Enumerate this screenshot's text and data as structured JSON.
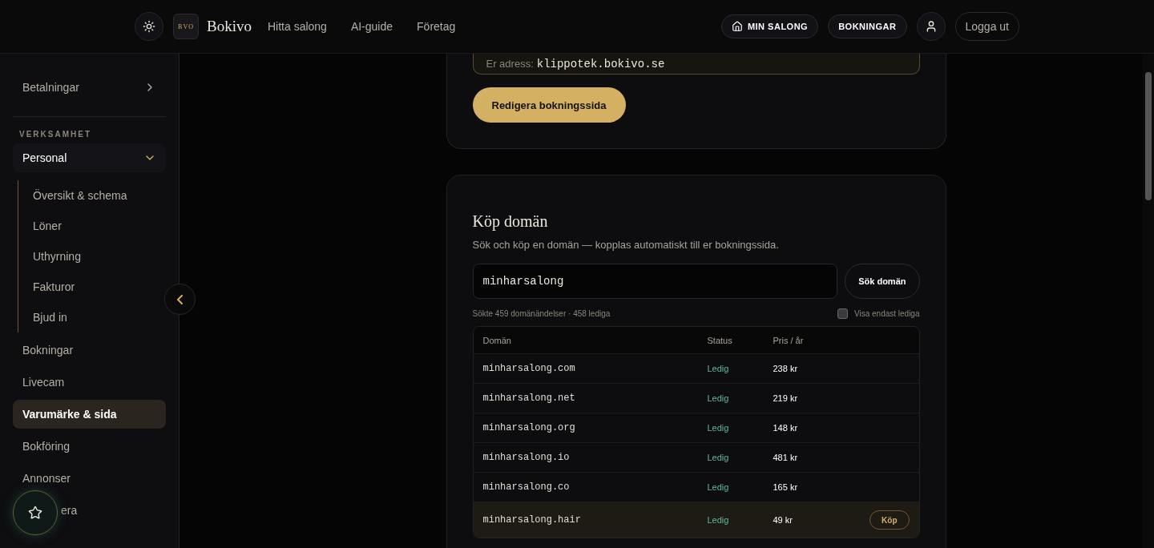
{
  "header": {
    "logo": {
      "mark": "BVO",
      "name": "Bokivo"
    },
    "nav": [
      "Hitta salong",
      "AI-guide",
      "Företag"
    ],
    "actions": [
      {
        "kind": "home",
        "label": "MIN SALONG"
      },
      {
        "kind": "plain",
        "label": "BOKNINGAR"
      },
      {
        "kind": "user"
      },
      {
        "kind": "logout",
        "label": "Logga ut"
      }
    ]
  },
  "sidebar": {
    "top": [
      {
        "label": "Betalningar",
        "expanded": false,
        "selected": false
      }
    ],
    "section_title": "VERKSAMHET",
    "items": [
      {
        "label": "Personal",
        "expanded": true,
        "selected": false,
        "children": [
          {
            "label": "Översikt & schema"
          },
          {
            "label": "Löner"
          },
          {
            "label": "Uthyrning"
          },
          {
            "label": "Fakturor"
          },
          {
            "label": "Bjud in"
          }
        ]
      },
      {
        "label": "Bokningar",
        "selected": false
      },
      {
        "label": "Livecam",
        "selected": false
      },
      {
        "label": "Varumärke & sida",
        "selected": true
      },
      {
        "label": "Bokföring",
        "selected": false
      },
      {
        "label": "Annonser",
        "selected": false
      },
      {
        "label": "era",
        "selected": false,
        "covered": true
      }
    ]
  },
  "address": {
    "label": "Er adress:",
    "value": "klippotek.bokivo.se"
  },
  "edit_button": "Redigera bokningssida",
  "domain_card": {
    "title": "Köp domän",
    "description": "Sök och köp en domän — kopplas automatiskt till er bokningssida.",
    "search_value": "minharsalong",
    "search_button": "Sök domän",
    "summary": "Sökte 459 domänändelser · 458 lediga",
    "filter": {
      "label": "Visa endast lediga",
      "checked": false
    },
    "columns": [
      "Domän",
      "Status",
      "Pris / år"
    ],
    "rows": [
      {
        "domain": "minharsalong.com",
        "status": "Ledig",
        "price": "238 kr",
        "selected": false
      },
      {
        "domain": "minharsalong.net",
        "status": "Ledig",
        "price": "219 kr",
        "selected": false
      },
      {
        "domain": "minharsalong.org",
        "status": "Ledig",
        "price": "148 kr",
        "selected": false
      },
      {
        "domain": "minharsalong.io",
        "status": "Ledig",
        "price": "481 kr",
        "selected": false
      },
      {
        "domain": "minharsalong.co",
        "status": "Ledig",
        "price": "165 kr",
        "selected": false
      },
      {
        "domain": "minharsalong.hair",
        "status": "Ledig",
        "price": "49 kr",
        "selected": true,
        "action": "Köp"
      }
    ]
  }
}
